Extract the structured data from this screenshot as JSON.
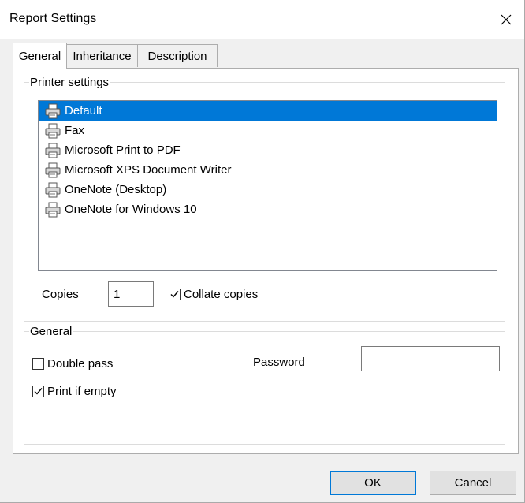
{
  "window": {
    "title": "Report Settings"
  },
  "tabs": [
    {
      "label": "General",
      "active": true
    },
    {
      "label": "Inheritance",
      "active": false
    },
    {
      "label": "Description",
      "active": false
    }
  ],
  "printer_settings": {
    "legend": "Printer settings",
    "printers": [
      {
        "label": "Default",
        "selected": true
      },
      {
        "label": "Fax",
        "selected": false
      },
      {
        "label": "Microsoft Print to PDF",
        "selected": false
      },
      {
        "label": "Microsoft XPS Document Writer",
        "selected": false
      },
      {
        "label": "OneNote (Desktop)",
        "selected": false
      },
      {
        "label": "OneNote for Windows 10",
        "selected": false
      }
    ],
    "copies_label": "Copies",
    "copies_value": "1",
    "collate_label": "Collate copies",
    "collate_checked": true
  },
  "general": {
    "legend": "General",
    "double_pass_label": "Double pass",
    "double_pass_checked": false,
    "print_if_empty_label": "Print if empty",
    "print_if_empty_checked": true,
    "password_label": "Password",
    "password_value": ""
  },
  "buttons": {
    "ok": "OK",
    "cancel": "Cancel"
  },
  "colors": {
    "selection": "#0078d7",
    "default_button_border": "#0078d7"
  },
  "icons": {
    "close": "close-icon",
    "printer": "printer-icon",
    "check": "checkmark-icon"
  }
}
